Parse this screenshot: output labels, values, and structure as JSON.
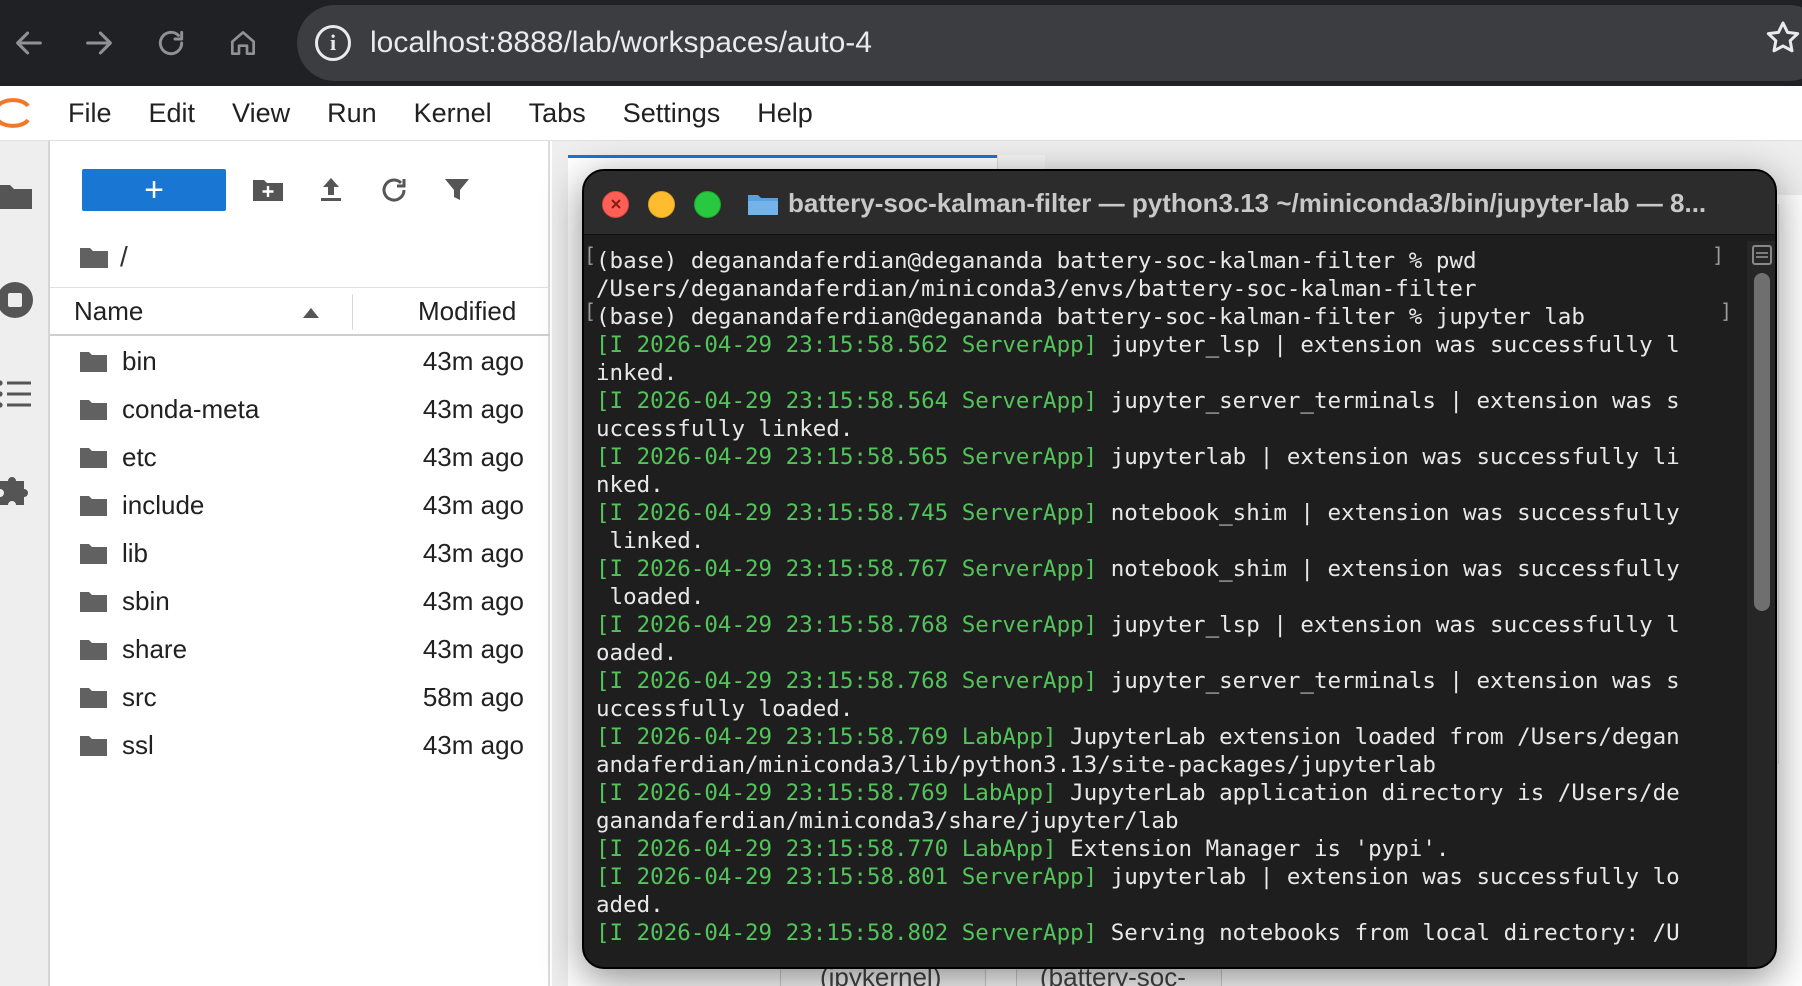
{
  "browser": {
    "url": "localhost:8888/lab/workspaces/auto-4",
    "info_symbol": "i"
  },
  "menu": {
    "items": [
      "File",
      "Edit",
      "View",
      "Run",
      "Kernel",
      "Tabs",
      "Settings",
      "Help"
    ]
  },
  "filebrowser": {
    "new_label": "+",
    "path": "/",
    "columns": {
      "name": "Name",
      "modified": "Modified"
    },
    "files": [
      {
        "name": "bin",
        "modified": "43m ago"
      },
      {
        "name": "conda-meta",
        "modified": "43m ago"
      },
      {
        "name": "etc",
        "modified": "43m ago"
      },
      {
        "name": "include",
        "modified": "43m ago"
      },
      {
        "name": "lib",
        "modified": "43m ago"
      },
      {
        "name": "sbin",
        "modified": "43m ago"
      },
      {
        "name": "share",
        "modified": "43m ago"
      },
      {
        "name": "src",
        "modified": "58m ago"
      },
      {
        "name": "ssl",
        "modified": "43m ago"
      }
    ]
  },
  "launcher": {
    "card_1": "(ipykernel)",
    "card_2": "(battery-soc-"
  },
  "terminal": {
    "title": "battery-soc-kalman-filter — python3.13 ~/miniconda3/bin/jupyter-lab — 8...",
    "prompt_lines": [
      "(base) deganandaferdian@degananda battery-soc-kalman-filter % pwd",
      "/Users/deganandaferdian/miniconda3/envs/battery-soc-kalman-filter",
      "(base) deganandaferdian@degananda battery-soc-kalman-filter % jupyter lab"
    ],
    "log_lines": [
      {
        "lvl": "[I 2026-04-29 23:15:58.562 ServerApp]",
        "msg": " jupyter_lsp | extension was successfully l"
      },
      {
        "lvl": "",
        "msg": "inked."
      },
      {
        "lvl": "[I 2026-04-29 23:15:58.564 ServerApp]",
        "msg": " jupyter_server_terminals | extension was s"
      },
      {
        "lvl": "",
        "msg": "uccessfully linked."
      },
      {
        "lvl": "[I 2026-04-29 23:15:58.565 ServerApp]",
        "msg": " jupyterlab | extension was successfully li"
      },
      {
        "lvl": "",
        "msg": "nked."
      },
      {
        "lvl": "[I 2026-04-29 23:15:58.745 ServerApp]",
        "msg": " notebook_shim | extension was successfully"
      },
      {
        "lvl": "",
        "msg": " linked."
      },
      {
        "lvl": "[I 2026-04-29 23:15:58.767 ServerApp]",
        "msg": " notebook_shim | extension was successfully"
      },
      {
        "lvl": "",
        "msg": " loaded."
      },
      {
        "lvl": "[I 2026-04-29 23:15:58.768 ServerApp]",
        "msg": " jupyter_lsp | extension was successfully l"
      },
      {
        "lvl": "",
        "msg": "oaded."
      },
      {
        "lvl": "[I 2026-04-29 23:15:58.768 ServerApp]",
        "msg": " jupyter_server_terminals | extension was s"
      },
      {
        "lvl": "",
        "msg": "uccessfully loaded."
      },
      {
        "lvl": "[I 2026-04-29 23:15:58.769 LabApp]",
        "msg": " JupyterLab extension loaded from /Users/degan"
      },
      {
        "lvl": "",
        "msg": "andaferdian/miniconda3/lib/python3.13/site-packages/jupyterlab"
      },
      {
        "lvl": "[I 2026-04-29 23:15:58.769 LabApp]",
        "msg": " JupyterLab application directory is /Users/de"
      },
      {
        "lvl": "",
        "msg": "ganandaferdian/miniconda3/share/jupyter/lab"
      },
      {
        "lvl": "[I 2026-04-29 23:15:58.770 LabApp]",
        "msg": " Extension Manager is 'pypi'."
      },
      {
        "lvl": "[I 2026-04-29 23:15:58.801 ServerApp]",
        "msg": " jupyterlab | extension was successfully lo"
      },
      {
        "lvl": "",
        "msg": "aded."
      },
      {
        "lvl": "[I 2026-04-29 23:15:58.802 ServerApp]",
        "msg": " Serving notebooks from local directory: /U"
      }
    ]
  },
  "colors": {
    "accent": "#1976d2",
    "log_green": "#52c45a",
    "browser_bg": "#202124",
    "terminal_bg": "#1e1e1e"
  }
}
